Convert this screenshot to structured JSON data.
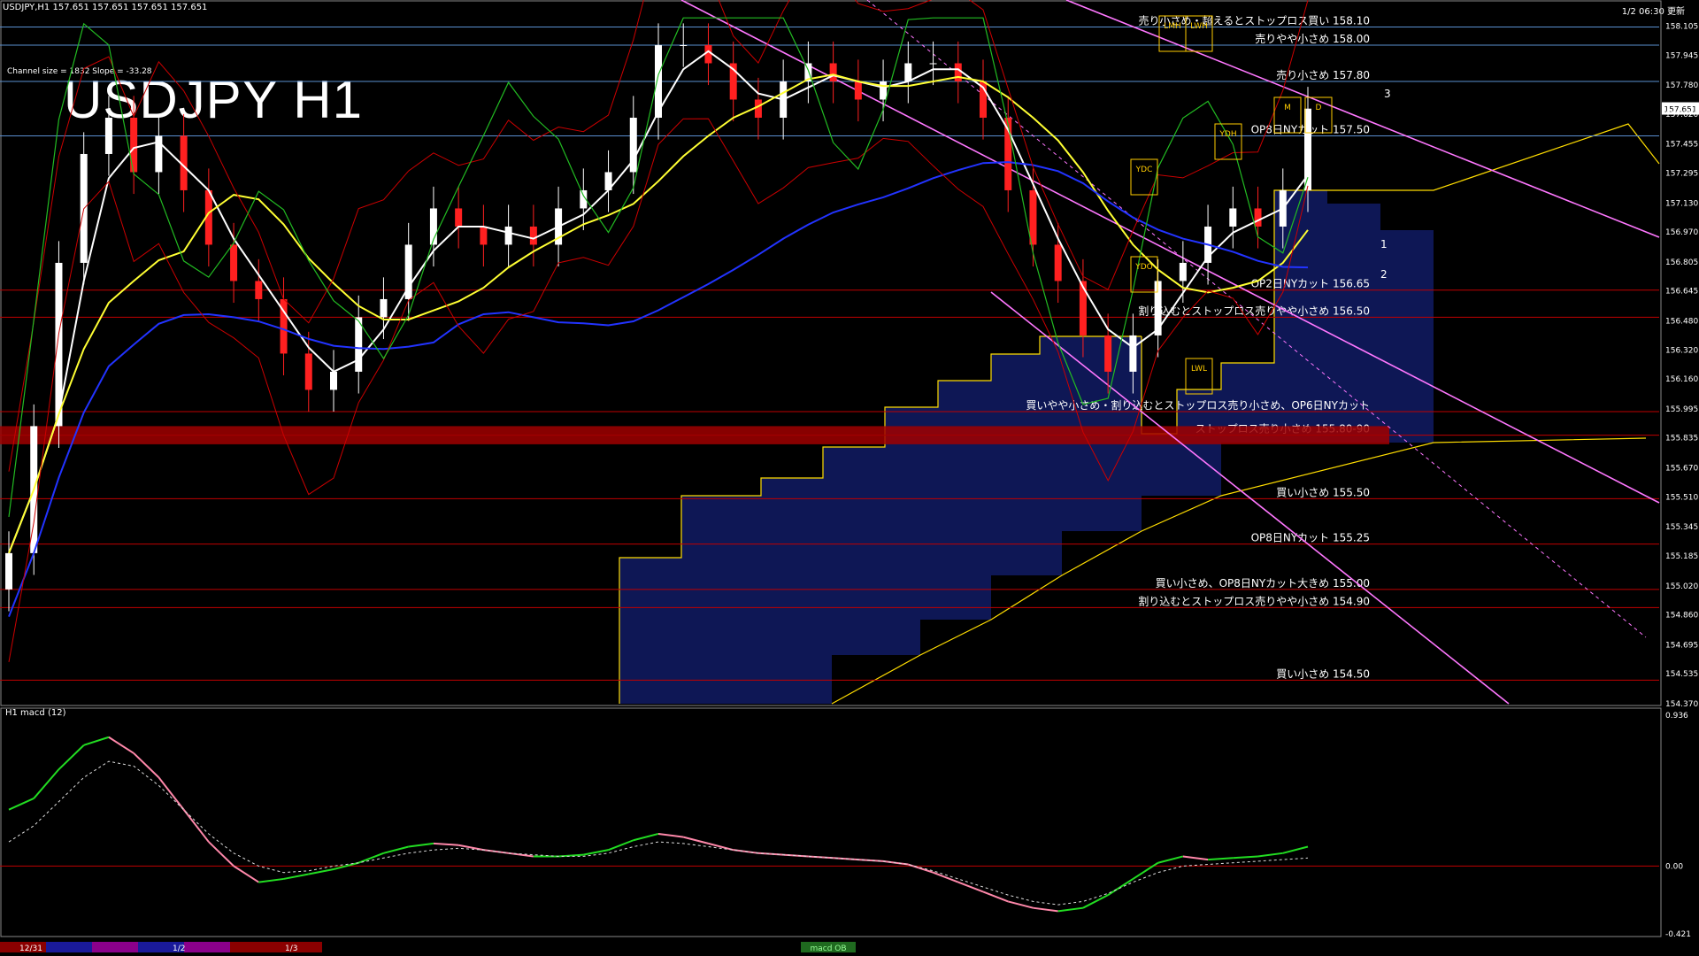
{
  "header": {
    "symbol_info": "USDJPY,H1  157.651 157.651 157.651 157.651",
    "big_title": "USDJPY H1",
    "channel_info": "Channel size = 1832 Slope = -33.28",
    "time_tag": "1/2 06:30 更新",
    "macd_title": "H1  macd (12)"
  },
  "chart_data": [
    {
      "type": "candlestick",
      "title": "USDJPY H1",
      "ylim": [
        154.37,
        158.2
      ],
      "y_ticks": [
        "158.105",
        "157.945",
        "157.780",
        "157.620",
        "157.455",
        "157.295",
        "157.130",
        "156.970",
        "156.805",
        "156.645",
        "156.480",
        "156.320",
        "156.160",
        "155.995",
        "155.835",
        "155.670",
        "155.510",
        "155.345",
        "155.185",
        "155.020",
        "154.860",
        "154.695",
        "154.535",
        "154.370"
      ],
      "current_price": "157.651",
      "close_series": [
        155.2,
        155.9,
        156.8,
        157.4,
        157.6,
        157.3,
        157.5,
        157.2,
        156.9,
        156.7,
        156.6,
        156.3,
        156.1,
        156.2,
        156.5,
        156.6,
        156.9,
        157.1,
        157.0,
        156.9,
        157.0,
        156.9,
        157.1,
        157.2,
        157.3,
        157.6,
        158.0,
        158.0,
        157.9,
        157.7,
        157.6,
        157.8,
        157.9,
        157.8,
        157.7,
        157.8,
        157.9,
        157.9,
        157.8,
        157.6,
        157.2,
        156.9,
        156.7,
        156.4,
        156.2,
        156.4,
        156.7,
        156.8,
        157.0,
        157.1,
        157.0,
        157.2,
        157.65
      ],
      "levels": [
        {
          "price": 158.1,
          "label": "売り小さめ・超えるとストップロス買い 158.10",
          "color": "#5a8fd0"
        },
        {
          "price": 158.0,
          "label": "売りやや小さめ 158.00",
          "color": "#5a8fd0"
        },
        {
          "price": 157.8,
          "label": "売り小さめ 157.80",
          "color": "#5a8fd0"
        },
        {
          "price": 157.5,
          "label": "OP8日NYカット 157.50",
          "color": "#5a8fd0"
        },
        {
          "price": 156.65,
          "label": "OP2日NYカット 156.65",
          "color": "#c00000"
        },
        {
          "price": 156.5,
          "label": "割り込むとストップロス売りやや小さめ 156.50",
          "color": "#c00000"
        },
        {
          "price": 155.98,
          "label": "買いやや小さめ・割り込むとストップロス売り小さめ、OP6日NYカット",
          "color": "#c00000"
        },
        {
          "price": 155.85,
          "label": "ストップロス売り小さめ 155.80-90",
          "color": "#c00000"
        },
        {
          "price": 155.5,
          "label": "買い小さめ 155.50",
          "color": "#c00000"
        },
        {
          "price": 155.25,
          "label": "OP8日NYカット 155.25",
          "color": "#c00000"
        },
        {
          "price": 155.0,
          "label": "買い小さめ、OP8日NYカット大きめ 155.00",
          "color": "#c00000"
        },
        {
          "price": 154.9,
          "label": "割り込むとストップロス売りやや小さめ 154.90",
          "color": "#c00000"
        },
        {
          "price": 154.5,
          "label": "買い小さめ 154.50",
          "color": "#c00000"
        }
      ],
      "box_labels": [
        "YDC",
        "YDO",
        "YDH",
        "LMH",
        "LWH",
        "LWL",
        "M",
        "D"
      ],
      "channel_labels": [
        "1",
        "2",
        "3"
      ],
      "x_labels": [
        "12/31",
        "1/2",
        "1/3"
      ]
    },
    {
      "type": "line",
      "title": "H1  macd (12)",
      "ylim": [
        -0.421,
        0.936
      ],
      "y_ticks": [
        "0.936",
        "0.00",
        "-0.421"
      ],
      "macd": [
        0.35,
        0.42,
        0.6,
        0.75,
        0.8,
        0.7,
        0.55,
        0.35,
        0.15,
        0.0,
        -0.1,
        -0.08,
        -0.05,
        -0.02,
        0.02,
        0.08,
        0.12,
        0.14,
        0.13,
        0.1,
        0.08,
        0.06,
        0.06,
        0.07,
        0.1,
        0.16,
        0.2,
        0.18,
        0.14,
        0.1,
        0.08,
        0.07,
        0.06,
        0.05,
        0.04,
        0.03,
        0.01,
        -0.04,
        -0.1,
        -0.16,
        -0.22,
        -0.26,
        -0.28,
        -0.26,
        -0.18,
        -0.08,
        0.02,
        0.06,
        0.04,
        0.05,
        0.06,
        0.08,
        0.12
      ],
      "signal": [
        0.15,
        0.25,
        0.4,
        0.55,
        0.65,
        0.62,
        0.5,
        0.35,
        0.2,
        0.08,
        0.0,
        -0.04,
        -0.03,
        0.0,
        0.02,
        0.05,
        0.08,
        0.1,
        0.11,
        0.1,
        0.08,
        0.07,
        0.06,
        0.06,
        0.08,
        0.12,
        0.15,
        0.14,
        0.12,
        0.1,
        0.08,
        0.07,
        0.06,
        0.05,
        0.04,
        0.03,
        0.01,
        -0.03,
        -0.08,
        -0.13,
        -0.18,
        -0.22,
        -0.24,
        -0.22,
        -0.17,
        -0.1,
        -0.04,
        0.0,
        0.01,
        0.02,
        0.03,
        0.04,
        0.05
      ],
      "footer_label": "macd OB"
    }
  ],
  "colors": {
    "bull": "#ffffff",
    "bear": "#ff2020",
    "grid_blue": "#5a8fd0",
    "grid_red": "#c00000",
    "ma_white": "#ffffff",
    "ma_yellow": "#ffff33",
    "ma_blue": "#2233ff",
    "band_red": "#cc0000",
    "chikou_green": "#22bb22",
    "cloud_gold": "#ffdd00",
    "channel_magenta": "#ff77ff",
    "macd_up": "#22dd22",
    "macd_down": "#ff88aa"
  }
}
